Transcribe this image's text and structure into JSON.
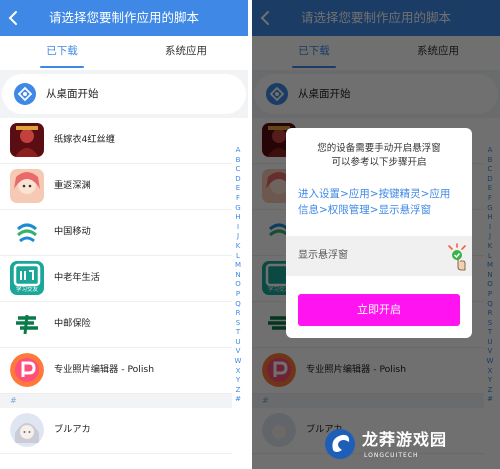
{
  "header": {
    "title": "请选择您要制作应用的脚本",
    "back_icon": "chevron-left-icon"
  },
  "tabs": [
    {
      "label": "已下载",
      "active": true
    },
    {
      "label": "系统应用",
      "active": false
    }
  ],
  "desktop_item": {
    "label": "从桌面开始",
    "icon": "desktop-start-icon"
  },
  "apps": [
    {
      "name": "纸嫁衣4红丝缠",
      "icon": "paper-bride-icon"
    },
    {
      "name": "重返深渊",
      "icon": "abyss-icon"
    },
    {
      "name": "中国移动",
      "icon": "china-mobile-icon"
    },
    {
      "name": "中老年生活",
      "icon": "elder-life-icon",
      "icon_caption": "学习交友"
    },
    {
      "name": "中邮保险",
      "icon": "post-insurance-icon"
    },
    {
      "name": "专业照片编辑器 - Polish",
      "icon": "polish-icon"
    },
    {
      "name": "ブルアカ",
      "icon": "blue-archive-icon"
    }
  ],
  "section_header": "#",
  "alphabet": [
    "A",
    "B",
    "C",
    "D",
    "E",
    "F",
    "G",
    "H",
    "I",
    "J",
    "K",
    "L",
    "M",
    "N",
    "O",
    "P",
    "Q",
    "R",
    "S",
    "T",
    "U",
    "V",
    "W",
    "X",
    "Y",
    "Z",
    "#"
  ],
  "dialog": {
    "message_line1": "您的设备需要手动开启悬浮窗",
    "message_line2": "可以参考以下步骤开启",
    "steps_line1": "进入设置>应用>按键精灵>应用",
    "steps_line2": "信息>权限管理>显示悬浮窗",
    "float_label": "显示悬浮窗",
    "button_label": "立即开启"
  },
  "watermark": {
    "text": "龙莽游戏园",
    "sub": "LONGCUITECH"
  },
  "colors": {
    "accent": "#3f88e6",
    "button": "#ff13f0",
    "background": "#f2f3f5"
  }
}
